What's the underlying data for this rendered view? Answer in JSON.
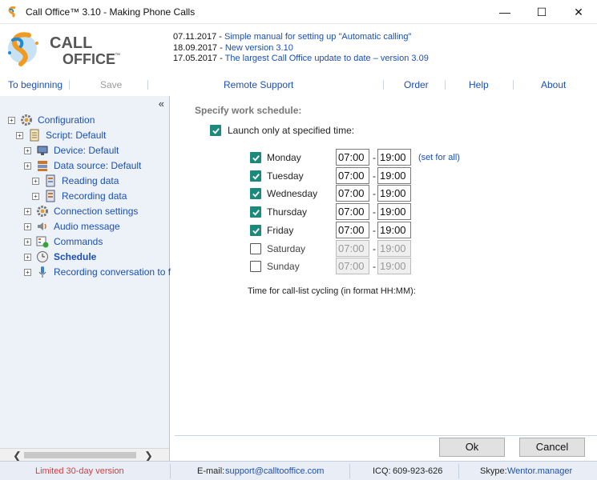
{
  "window": {
    "title": "Call Office™ 3.10 - Making Phone Calls",
    "minimize_glyph": "—",
    "maximize_glyph": "☐",
    "close_glyph": "✕"
  },
  "logo": {
    "line1": "CALL",
    "line2": "OFFICE",
    "mark": "™"
  },
  "news": [
    {
      "date": "07.11.2017 - ",
      "text": "Simple manual for setting up \"Automatic calling\""
    },
    {
      "date": "18.09.2017 - ",
      "text": "New version 3.10"
    },
    {
      "date": "17.05.2017 - ",
      "text": "The largest Call Office update to date – version 3.09"
    }
  ],
  "menu": {
    "to_beginning": "To beginning",
    "save": "Save",
    "remote_support": "Remote Support",
    "order": "Order",
    "help": "Help",
    "about": "About"
  },
  "tree": {
    "collapse_glyph": "«",
    "items": [
      {
        "label": "Configuration",
        "icon": "gear-icon"
      },
      {
        "label": "Script: Default",
        "icon": "script-icon"
      },
      {
        "label": "Device: Default",
        "icon": "device-icon"
      },
      {
        "label": "Data source: Default",
        "icon": "database-icon"
      },
      {
        "label": "Reading data",
        "icon": "reading-data-icon"
      },
      {
        "label": "Recording data",
        "icon": "recording-data-icon"
      },
      {
        "label": "Connection settings",
        "icon": "connection-gear-icon"
      },
      {
        "label": "Audio message",
        "icon": "speaker-icon"
      },
      {
        "label": "Commands",
        "icon": "commands-icon"
      },
      {
        "label": "Schedule",
        "icon": "clock-icon"
      },
      {
        "label": "Recording conversation to f",
        "icon": "microphone-icon"
      }
    ]
  },
  "schedule": {
    "title": "Specify work schedule:",
    "launch_label": "Launch only at specified time:",
    "launch_checked": true,
    "dash": "-",
    "set_for_all": "(set for all)",
    "days": [
      {
        "name": "Monday",
        "checked": true,
        "from": "07:00",
        "to": "19:00"
      },
      {
        "name": "Tuesday",
        "checked": true,
        "from": "07:00",
        "to": "19:00"
      },
      {
        "name": "Wednesday",
        "checked": true,
        "from": "07:00",
        "to": "19:00"
      },
      {
        "name": "Thursday",
        "checked": true,
        "from": "07:00",
        "to": "19:00"
      },
      {
        "name": "Friday",
        "checked": true,
        "from": "07:00",
        "to": "19:00"
      },
      {
        "name": "Saturday",
        "checked": false,
        "from": "07:00",
        "to": "19:00"
      },
      {
        "name": "Sunday",
        "checked": false,
        "from": "07:00",
        "to": "19:00"
      }
    ],
    "cycling_label": "Time for call-list cycling (in format HH:MM):"
  },
  "buttons": {
    "ok": "Ok",
    "cancel": "Cancel"
  },
  "status": {
    "limited": "Limited 30-day version",
    "email_label": "E-mail: ",
    "email": "support@calltooffice.com",
    "icq_label": "ICQ: ",
    "icq": "609-923-626",
    "skype_label": "Skype: ",
    "skype": "Wentor.manager"
  },
  "colors": {
    "accent": "#1a4fb8",
    "check": "#1b8a7a",
    "limited": "#d93a3a"
  }
}
